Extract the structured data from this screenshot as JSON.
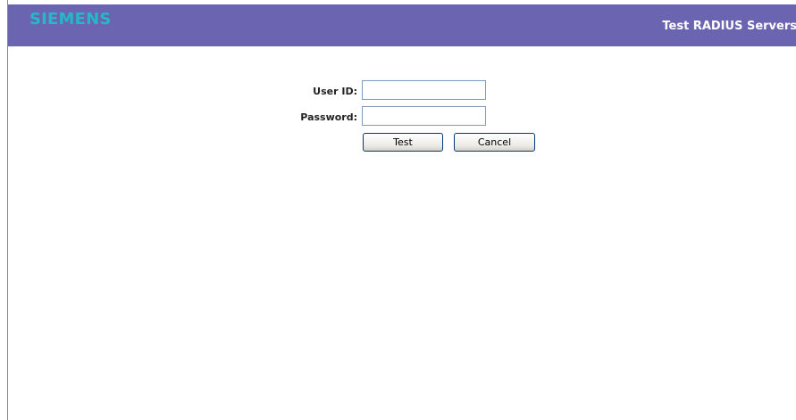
{
  "header": {
    "logo_text": "SIEMENS",
    "title": "Test RADIUS Servers",
    "background_color": "#6b64b0",
    "logo_color": "#22b9c8"
  },
  "form": {
    "user_id_label": "User ID:",
    "user_id_value": "",
    "password_label": "Password:",
    "password_value": "",
    "test_button_label": "Test",
    "cancel_button_label": "Cancel"
  }
}
